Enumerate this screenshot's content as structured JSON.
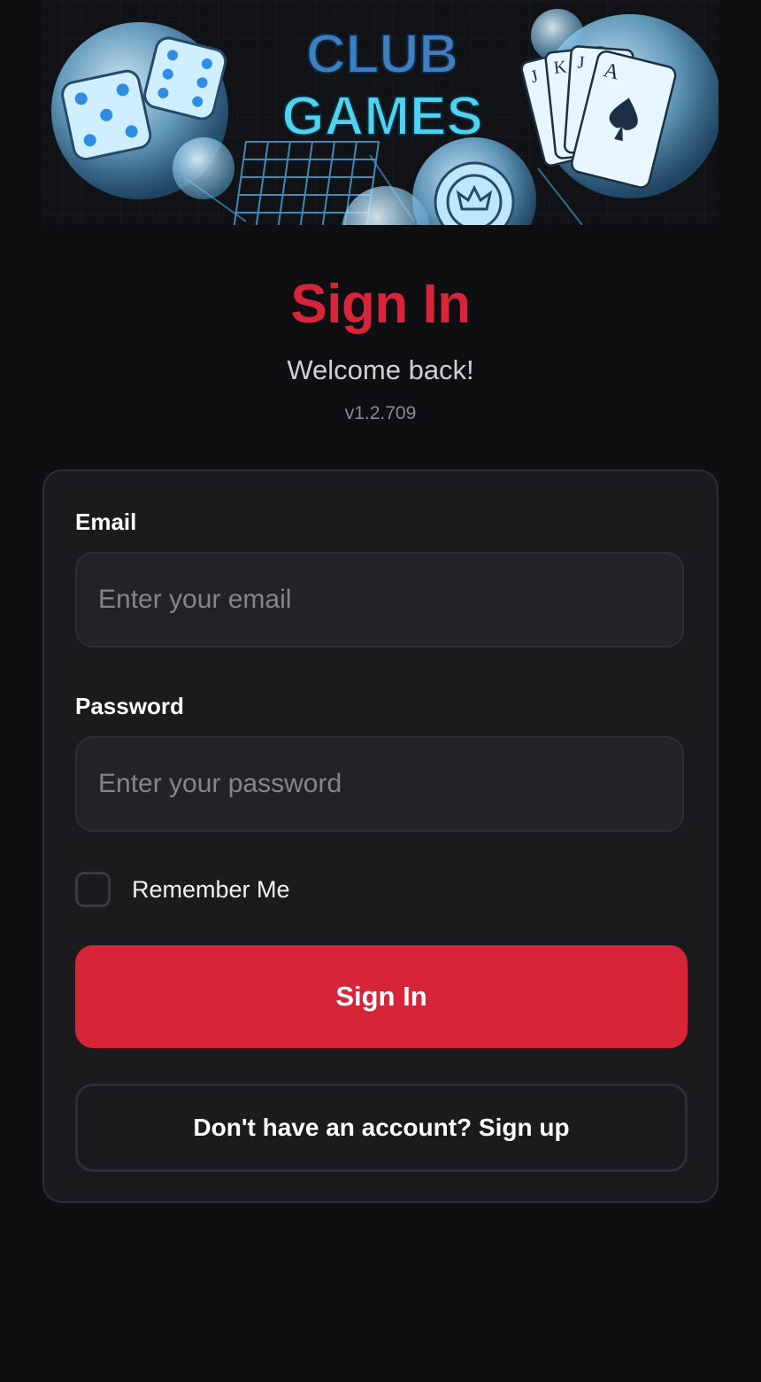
{
  "banner": {
    "line1": "CLUB",
    "line2": "GAMES",
    "colors": {
      "line1": "#3f7fc0",
      "line2": "#4fd3f0",
      "glow": "#7fd1ff"
    },
    "card_ranks": [
      "J",
      "K",
      "J",
      "A"
    ]
  },
  "header": {
    "title": "Sign In",
    "subtitle": "Welcome back!",
    "version": "v1.2.709"
  },
  "form": {
    "email_label": "Email",
    "email_placeholder": "Enter your email",
    "email_value": "",
    "password_label": "Password",
    "password_placeholder": "Enter your password",
    "password_value": "",
    "remember_label": "Remember Me",
    "remember_checked": false,
    "submit_label": "Sign In",
    "signup_label": "Don't have an account? Sign up"
  },
  "colors": {
    "background": "#0f0f11",
    "card": "#1b1b1e",
    "accent": "#d72538",
    "title": "#d92539"
  }
}
